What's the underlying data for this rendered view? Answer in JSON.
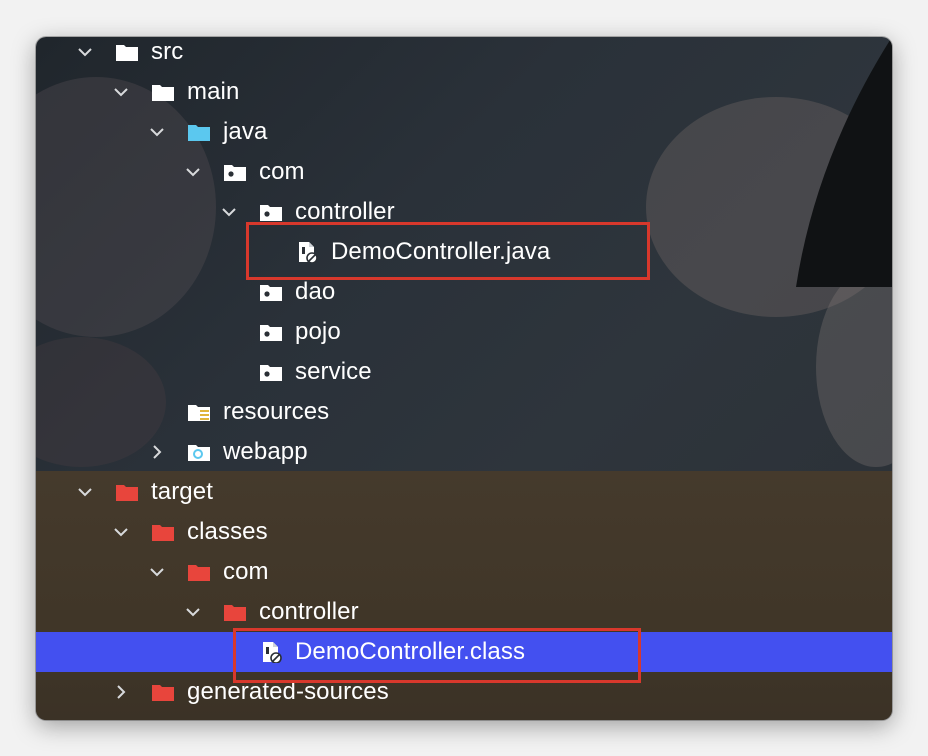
{
  "tree": {
    "items": [
      {
        "label": "src",
        "icon": "folder-icon",
        "expanded": true,
        "selected": false
      },
      {
        "label": "main",
        "icon": "folder-icon",
        "expanded": true,
        "selected": false
      },
      {
        "label": "java",
        "icon": "source-folder-icon",
        "expanded": true,
        "selected": false
      },
      {
        "label": "com",
        "icon": "package-icon",
        "expanded": true,
        "selected": false
      },
      {
        "label": "controller",
        "icon": "package-icon",
        "expanded": true,
        "selected": false
      },
      {
        "label": "DemoController.java",
        "icon": "java-file-icon",
        "expanded": null,
        "selected": false,
        "highlighted": true
      },
      {
        "label": "dao",
        "icon": "package-icon",
        "expanded": null,
        "selected": false
      },
      {
        "label": "pojo",
        "icon": "package-icon",
        "expanded": null,
        "selected": false
      },
      {
        "label": "service",
        "icon": "package-icon",
        "expanded": null,
        "selected": false
      },
      {
        "label": "resources",
        "icon": "resources-folder-icon",
        "expanded": null,
        "selected": false
      },
      {
        "label": "webapp",
        "icon": "web-folder-icon",
        "expanded": false,
        "selected": false
      },
      {
        "label": "target",
        "icon": "excluded-folder-icon",
        "expanded": true,
        "selected": false
      },
      {
        "label": "classes",
        "icon": "excluded-folder-icon",
        "expanded": true,
        "selected": false
      },
      {
        "label": "com",
        "icon": "excluded-folder-icon",
        "expanded": true,
        "selected": false
      },
      {
        "label": "controller",
        "icon": "excluded-folder-icon",
        "expanded": true,
        "selected": false
      },
      {
        "label": "DemoController.class",
        "icon": "class-file-icon",
        "expanded": null,
        "selected": true,
        "highlighted": true
      },
      {
        "label": "generated-sources",
        "icon": "excluded-folder-icon",
        "expanded": false,
        "selected": false
      }
    ]
  },
  "colors": {
    "selection": "#4350f0",
    "highlight_border": "#d8382c",
    "excluded_folder": "#e8453c",
    "source_folder": "#5bc8ef",
    "text": "#ffffff"
  }
}
